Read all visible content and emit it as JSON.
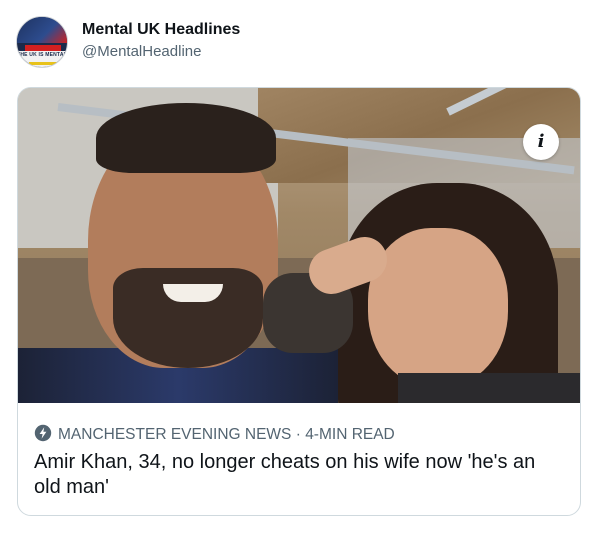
{
  "tweet": {
    "author_name": "Mental UK Headlines",
    "author_handle": "@MentalHeadline",
    "avatar_text": "THE UK IS MENTAL"
  },
  "card": {
    "image_alt": "Amir Khan and his wife selfie",
    "info_label": "i",
    "source_icon": "bolt-icon",
    "source": "MANCHESTER EVENING NEWS",
    "separator": "·",
    "read_time": "4-MIN READ",
    "headline": "Amir Khan, 34, no longer cheats on his wife now 'he's an old man'"
  },
  "colors": {
    "text_primary": "#0f1419",
    "text_secondary": "#536471",
    "border": "#cfd9de"
  }
}
